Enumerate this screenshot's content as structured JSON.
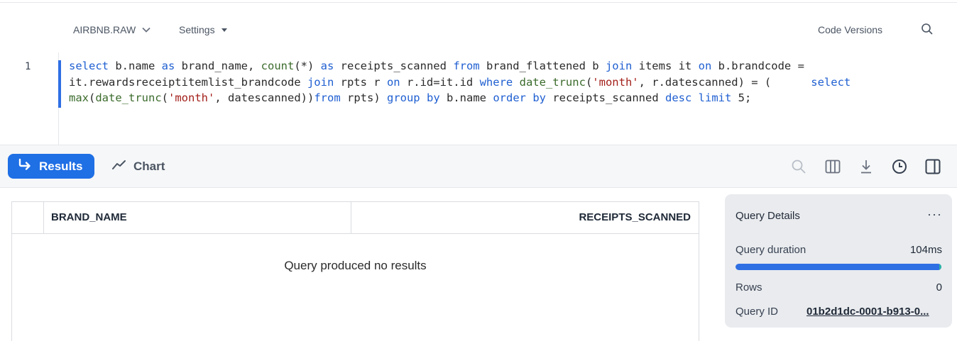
{
  "toolbar": {
    "database": "AIRBNB.RAW",
    "settings": "Settings",
    "code_versions": "Code Versions",
    "search_icon": "search-icon"
  },
  "editor": {
    "line_number": "1",
    "sql_line1": "select b.name as brand_name, count(*) as receipts_scanned from brand_flattened b join items it on b.brandcode =",
    "sql_line2": "it.rewardsreceiptitemlist_brandcode join rpts r on r.id=it.id where date_trunc('month', r.datescanned) = (      select",
    "sql_line3": "max(date_trunc('month', datescanned))from rpts) group by b.name order by receipts_scanned desc limit 5;"
  },
  "results_bar": {
    "results_label": "Results",
    "chart_label": "Chart",
    "icons": [
      "search-icon",
      "columns-icon",
      "download-icon",
      "history-icon",
      "split-panel-icon"
    ]
  },
  "table": {
    "columns": [
      "BRAND_NAME",
      "RECEIPTS_SCANNED"
    ],
    "empty_message": "Query produced no results"
  },
  "details": {
    "title": "Query Details",
    "more": "···",
    "duration_label": "Query duration",
    "duration_value": "104ms",
    "duration_progress": 1.0,
    "rows_label": "Rows",
    "rows_value": "0",
    "query_id_label": "Query ID",
    "query_id_value": "01b2d1dc-0001-b913-0..."
  },
  "colors": {
    "accent": "#1f6fe5",
    "keyword": "#1f5fd1",
    "string": "#a3201b"
  }
}
